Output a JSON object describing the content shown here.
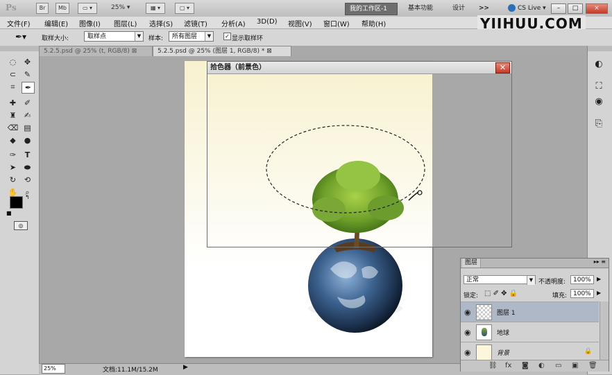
{
  "app": {
    "logo": "Ps",
    "zoom": "25%",
    "workspaces": {
      "active": "我的工作区-1",
      "basic": "基本功能",
      "design": "设计",
      "more": ">>"
    },
    "cs_live": "CS Live",
    "window_buttons": {
      "minimize": "–",
      "restore": "□",
      "close": "×"
    },
    "watermark": "YIIHUU.COM"
  },
  "menu": [
    "文件(F)",
    "编辑(E)",
    "图像(I)",
    "图层(L)",
    "选择(S)",
    "滤镜(T)",
    "分析(A)",
    "3D(D)",
    "视图(V)",
    "窗口(W)",
    "帮助(H)"
  ],
  "options": {
    "sample_size_label": "取样大小:",
    "sample_size_value": "取样点",
    "sample_label": "样本:",
    "sample_value": "所有图层",
    "show_ring_label": "显示取样环",
    "show_ring_checked": true
  },
  "tabs": [
    {
      "label": "5.2.5.psd @ 25% (t, RGB/8)",
      "active": false
    },
    {
      "label": "5.2.5.psd @ 25% (图层 1, RGB/8) *",
      "active": true
    }
  ],
  "picker": {
    "title": "拾色器（前景色）",
    "close": "✕"
  },
  "status": {
    "zoom": "25%",
    "doc": "文档:11.1M/15.2M",
    "arrow": "▶"
  },
  "layers_panel": {
    "tab": "图层",
    "blend_mode": "正常",
    "opacity_label": "不透明度:",
    "opacity_value": "100%",
    "lock_label": "锁定:",
    "fill_label": "填充:",
    "fill_value": "100%",
    "layers": [
      {
        "name": "图层 1",
        "selected": true
      },
      {
        "name": "地球",
        "selected": false
      },
      {
        "name": "背景",
        "selected": false,
        "locked": true
      }
    ]
  },
  "colors": {
    "foreground": "#000000",
    "background": "#ffffff",
    "picker_close": "#c23a26"
  }
}
